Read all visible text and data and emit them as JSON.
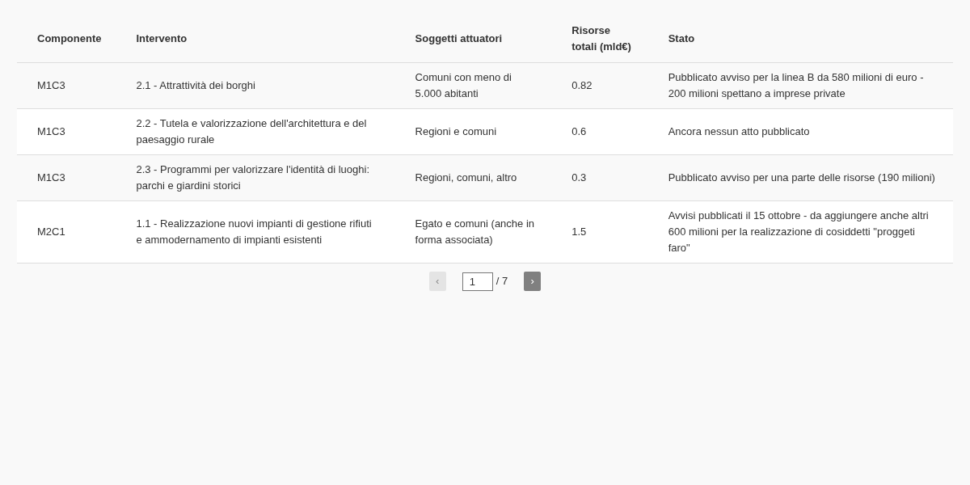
{
  "table": {
    "columns": [
      "Componente",
      "Intervento",
      "Soggetti attuatori",
      "Risorse totali (mld€)",
      "Stato"
    ],
    "rows": [
      [
        "M1C3",
        "2.1 - Attrattività dei borghi",
        "Comuni con meno di 5.000 abitanti",
        "0.82",
        "Pubblicato avviso per la linea B da 580 milioni di euro - 200 milioni spettano a imprese private"
      ],
      [
        "M1C3",
        "2.2 - Tutela e valorizzazione dell'architettura e del paesaggio rurale",
        "Regioni e comuni",
        "0.6",
        "Ancora nessun atto pubblicato"
      ],
      [
        "M1C3",
        "2.3 - Programmi per valorizzare l'identità di luoghi: parchi e giardini storici",
        "Regioni, comuni, altro",
        "0.3",
        "Pubblicato avviso per una parte delle risorse (190 milioni)"
      ],
      [
        "M2C1",
        "1.1 - Realizzazione nuovi impianti di gestione rifiuti e ammodernamento di impianti esistenti",
        "Egato e comuni (anche in forma associata)",
        "1.5",
        "Avvisi pubblicati il 15 ottobre - da aggiungere anche altri 600 milioni per la realizzazione di cosiddetti \"proggeti faro\""
      ]
    ]
  },
  "pagination": {
    "previous": {
      "label": "‹",
      "disabled": true
    },
    "page": "1",
    "total": "/ 7",
    "next": {
      "label": "›",
      "disabled": false
    }
  }
}
